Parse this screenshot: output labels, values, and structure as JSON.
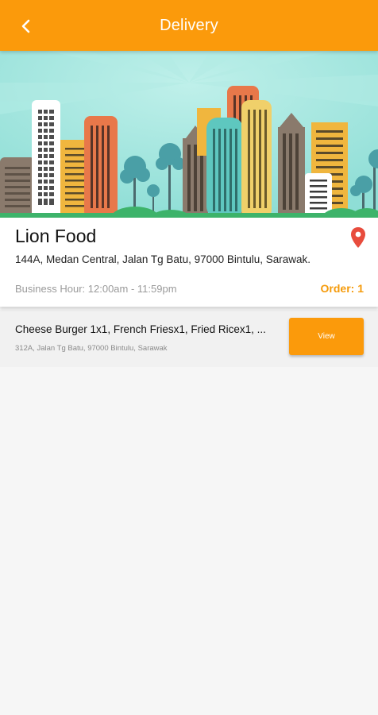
{
  "header": {
    "title": "Delivery",
    "back_icon": "chevron-left-icon",
    "background_color": "#fb9a0b"
  },
  "store": {
    "name": "Lion Food",
    "address": "144A, Medan Central, Jalan Tg Batu, 97000 Bintulu, Sarawak.",
    "business_hour": "Business Hour: 12:00am - 11:59pm",
    "order_count": "Order: 1",
    "location_icon": "map-pin-icon",
    "pin_color": "#e84c3d"
  },
  "orders": [
    {
      "items": "Cheese Burger 1x1, French Friesx1, Fried Ricex1, ...",
      "address": "312A, Jalan Tg Batu, 97000 Bintulu, Sarawak",
      "view_label": "View"
    }
  ],
  "colors": {
    "accent": "#fb9a0b",
    "order_text": "#f59b0b",
    "banner_sky": "#9ee3dc"
  }
}
